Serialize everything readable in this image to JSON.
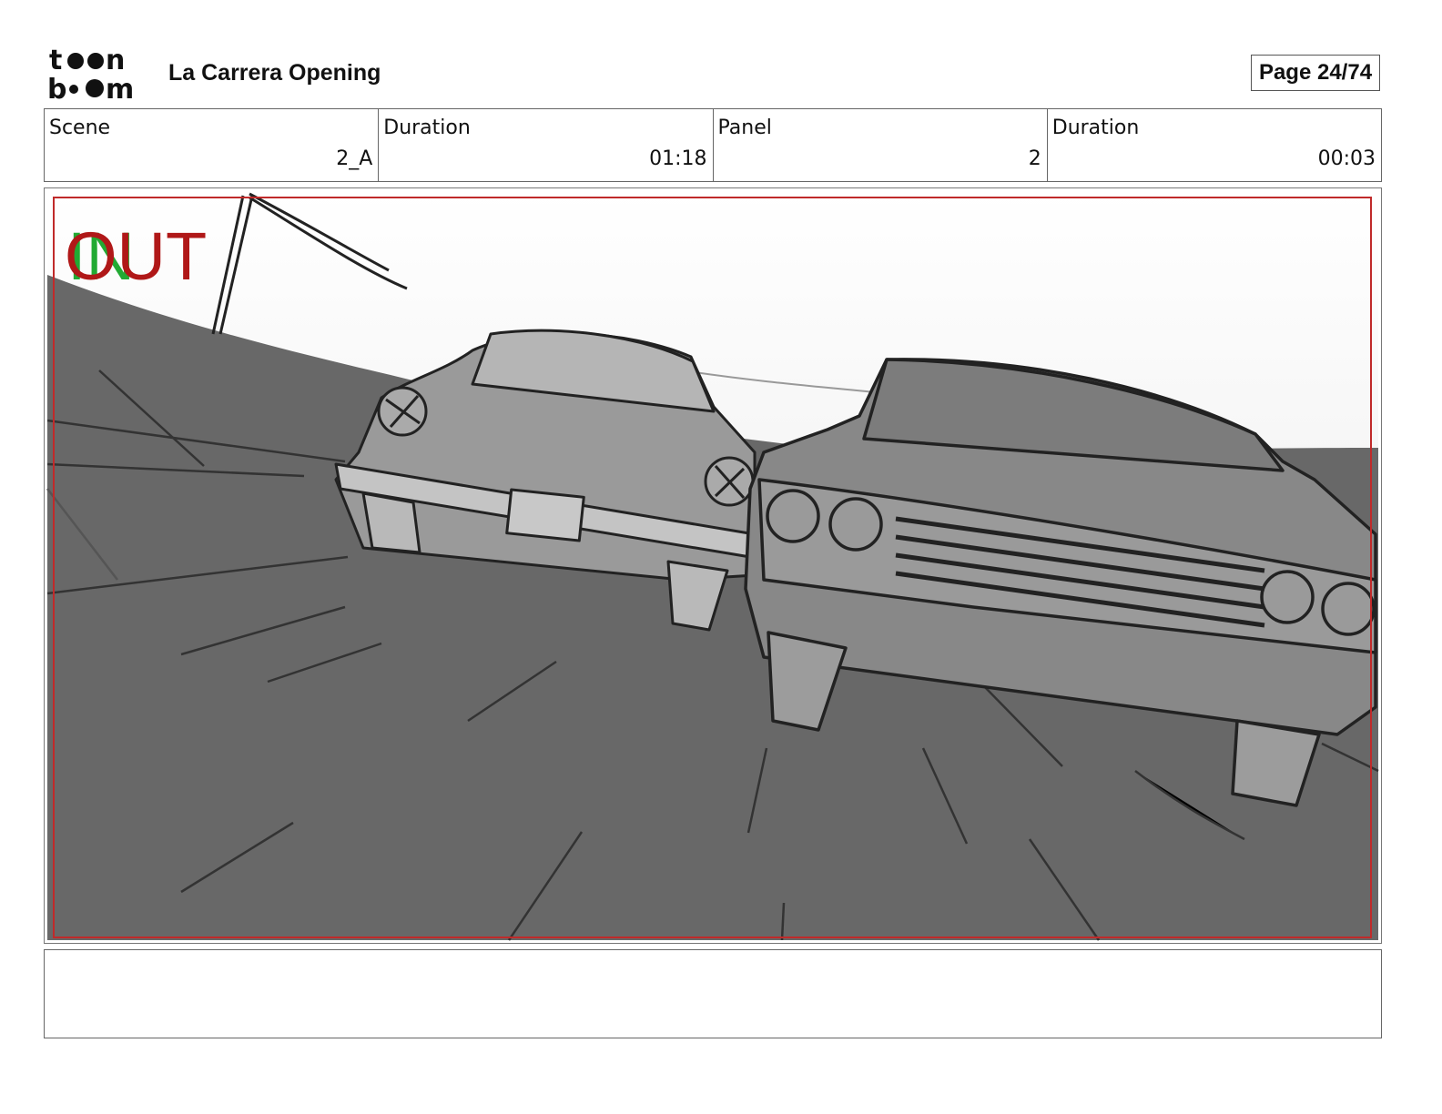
{
  "header": {
    "logo_text": "toon boom",
    "project_title": "La Carrera Opening",
    "page_label": "Page 24/74"
  },
  "info": {
    "scene_label": "Scene",
    "scene_value": "2_A",
    "scene_duration_label": "Duration",
    "scene_duration_value": "01:18",
    "panel_label": "Panel",
    "panel_value": "2",
    "panel_duration_label": "Duration",
    "panel_duration_value": "00:03"
  },
  "panel": {
    "in_marker": "IN",
    "out_marker": "OUT",
    "in_color": "#22aa33",
    "out_color": "#b01818",
    "safe_frame_color": "#c02a2a"
  },
  "notes": {
    "text": ""
  }
}
